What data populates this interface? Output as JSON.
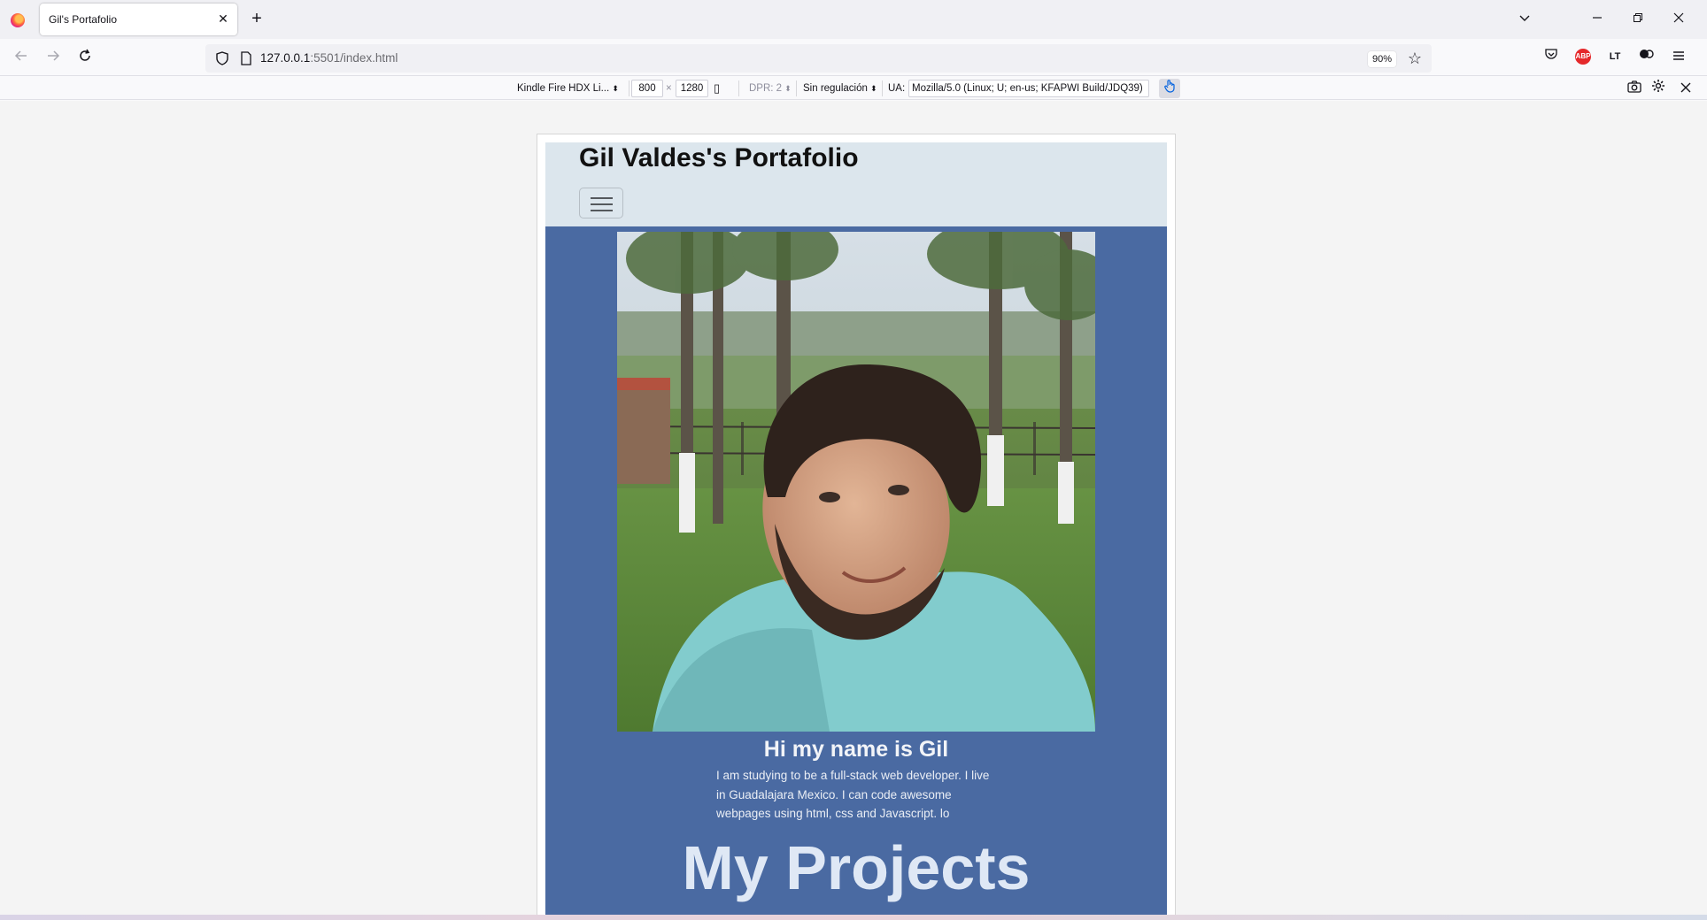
{
  "browser": {
    "tab": {
      "title": "Gil's Portafolio",
      "close": "✕"
    },
    "new_tab": "+",
    "window_buttons": {
      "list_all": "⌄",
      "minimize": "—",
      "restore": "❐",
      "close": "✕"
    },
    "nav": {
      "back": "←",
      "forward": "→",
      "reload": "↻"
    },
    "url": {
      "host": "127.0.0.1",
      "rest": ":5501/index.html"
    },
    "zoom": "90%",
    "bookmark_icon": "☆",
    "extensions": [
      "pocket-icon",
      "adblock-icon",
      "languagetool-icon",
      "extensions-icon",
      "menu-icon"
    ],
    "abp_label": "ABP",
    "lt_label": "LT"
  },
  "rdm": {
    "device": "Kindle Fire HDX Li...",
    "width": "800",
    "times": "×",
    "height": "1280",
    "dpr": "DPR: 2",
    "throttle": "Sin regulación",
    "ua_label": "UA:",
    "ua_value": "Mozilla/5.0 (Linux; U; en-us; KFAPWI Build/JDQ39)"
  },
  "site": {
    "title": "Gil Valdes's Portafolio",
    "greeting": "Hi my name is Gil",
    "bio": "I am studying to be a full-stack web developer. I live in Guadalajara Mexico. I can code awesome webpages using html, css and Javascript. lo",
    "projects_heading": "My Projects",
    "colors": {
      "header_bg": "#dce6ed",
      "body_bg": "#4a6aa2"
    }
  }
}
